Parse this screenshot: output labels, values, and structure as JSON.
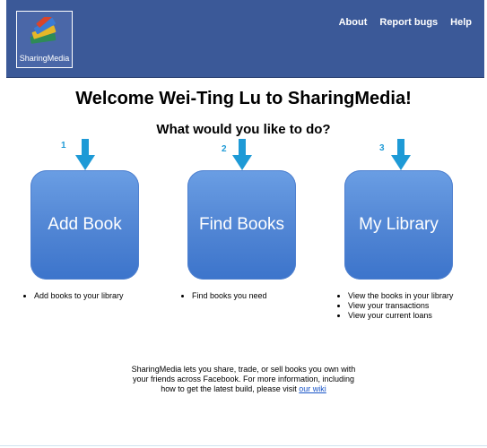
{
  "header": {
    "logo_text": "SharingMedia",
    "nav": [
      "About",
      "Report bugs",
      "Help"
    ]
  },
  "main": {
    "welcome": "Welcome Wei-Ting Lu to SharingMedia!",
    "question": "What would you like to do?",
    "actions": [
      {
        "number": "1",
        "label": "Add Book",
        "bullets": [
          "Add books to your library"
        ]
      },
      {
        "number": "2",
        "label": "Find Books",
        "bullets": [
          "Find books you need"
        ]
      },
      {
        "number": "3",
        "label": "My Library",
        "bullets": [
          "View the books in your library",
          "View your transactions",
          "View your current loans"
        ]
      }
    ]
  },
  "footer": {
    "line1": "SharingMedia lets you share, trade, or sell books you own with",
    "line2": "your friends across Facebook. For more information, including",
    "line3_prefix": "how to get the latest build, please visit ",
    "link": "our wiki"
  },
  "colors": {
    "header_bg": "#3b5998",
    "button_blue": "#5589d6",
    "arrow_blue": "#1e9ad6",
    "link": "#1a55c7"
  },
  "icons": [
    "books-logo-icon",
    "down-arrow-icon"
  ]
}
